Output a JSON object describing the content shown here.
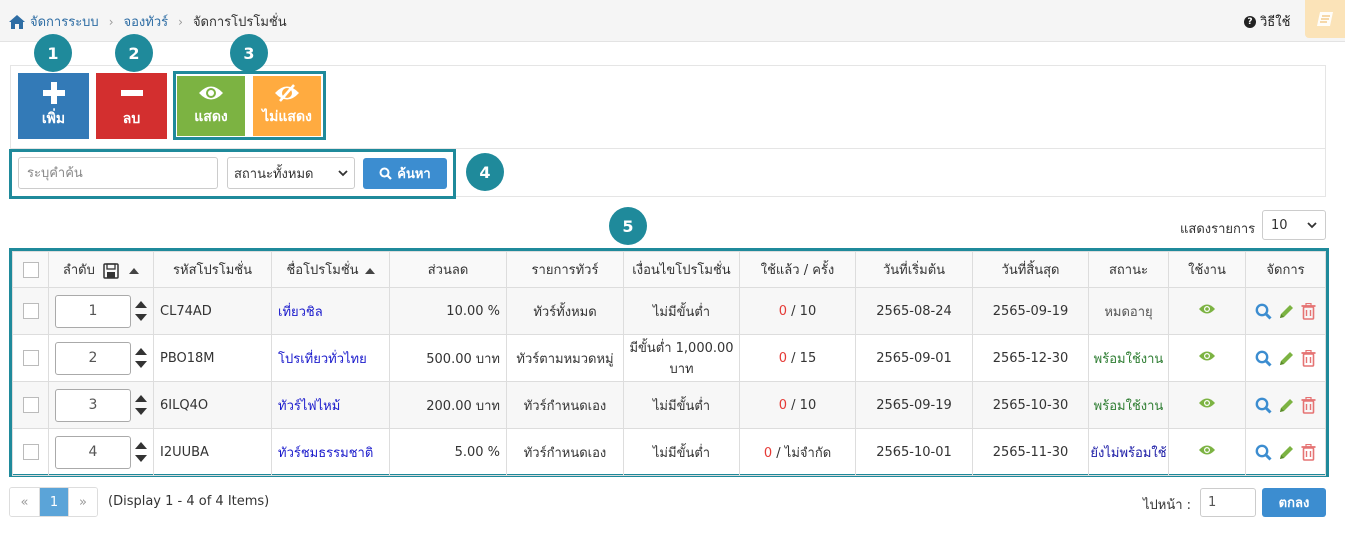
{
  "breadcrumb": {
    "items": [
      "จัดการระบบ",
      "จองทัวร์"
    ],
    "current": "จัดการโปรโมชั่น"
  },
  "help": {
    "label": "วิธีใช้"
  },
  "toolbar": {
    "add_label": "เพิ่ม",
    "delete_label": "ลบ",
    "show_label": "แสดง",
    "hide_label": "ไม่แสดง"
  },
  "badges": [
    "1",
    "2",
    "3",
    "4",
    "5"
  ],
  "search": {
    "placeholder": "ระบุคำค้น",
    "status_value": "สถานะทั้งหมด",
    "button_label": "ค้นหา"
  },
  "per_page": {
    "label": "แสดงรายการ",
    "value": "10"
  },
  "table": {
    "headers": [
      "ลำดับ",
      "รหัสโปรโมชั่น",
      "ชื่อโปรโมชั่น",
      "ส่วนลด",
      "รายการทัวร์",
      "เงื่อนไขโปรโมชั่น",
      "ใช้แล้ว / ครั้ง",
      "วันที่เริ่มต้น",
      "วันที่สิ้นสุด",
      "สถานะ",
      "ใช้งาน",
      "จัดการ"
    ],
    "rows": [
      {
        "order": "1",
        "code": "CL74AD",
        "name": "เที่ยวชิล",
        "discount": "10.00 %",
        "tours": "ทัวร์ทั้งหมด",
        "condition": "ไม่มีขั้นต่ำ",
        "used": "0",
        "limit": "/ 10",
        "start": "2565-08-24",
        "end": "2565-09-19",
        "status": "หมดอายุ",
        "status_color": "#555555"
      },
      {
        "order": "2",
        "code": "PBO18M",
        "name": "โปรเที่ยวทั่วไทย",
        "discount": "500.00 บาท",
        "tours": "ทัวร์ตามหมวดหมู่",
        "condition": "มีขั้นต่ำ 1,000.00 บาท",
        "used": "0",
        "limit": "/ 15",
        "start": "2565-09-01",
        "end": "2565-12-30",
        "status": "พร้อมใช้งาน",
        "status_color": "#2e7d32"
      },
      {
        "order": "3",
        "code": "6ILQ4O",
        "name": "ทัวร์ไฟไหม้",
        "discount": "200.00 บาท",
        "tours": "ทัวร์กำหนดเอง",
        "condition": "ไม่มีขั้นต่ำ",
        "used": "0",
        "limit": "/ 10",
        "start": "2565-09-19",
        "end": "2565-10-30",
        "status": "พร้อมใช้งาน",
        "status_color": "#2e7d32"
      },
      {
        "order": "4",
        "code": "I2UUBA",
        "name": "ทัวร์ชมธรรมชาติ",
        "discount": "5.00 %",
        "tours": "ทัวร์กำหนดเอง",
        "condition": "ไม่มีขั้นต่ำ",
        "used": "0",
        "limit": "/ ไม่จำกัด",
        "start": "2565-10-01",
        "end": "2565-11-30",
        "status": "ยังไม่พร้อมใช้",
        "status_color": "#1a1aa6"
      }
    ]
  },
  "pagination": {
    "prev": "«",
    "page": "1",
    "next": "»",
    "display_text": "(Display 1 - 4 of 4 Items)",
    "goto_label": "ไปหน้า :",
    "goto_value": "1",
    "goto_button": "ตกลง"
  },
  "colors": {
    "accent": "#1f8a9b",
    "primary": "#337ab7",
    "danger": "#d32f2f",
    "success": "#7cb342",
    "warning": "#ffab40"
  }
}
